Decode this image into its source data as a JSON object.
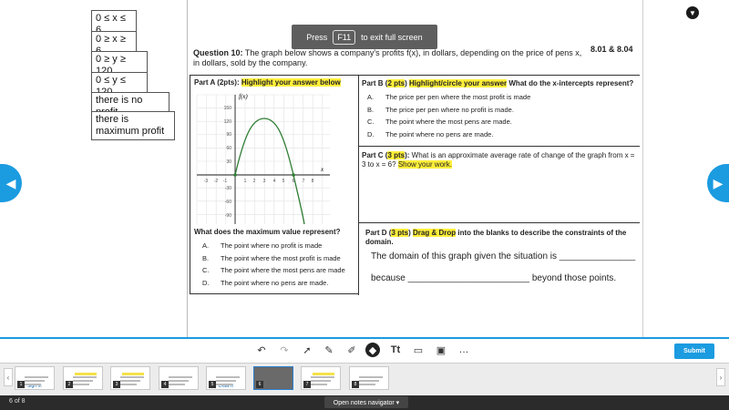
{
  "tiles": [
    {
      "text": "0 ≤ x ≤ 6"
    },
    {
      "text": "0 ≥ x ≥ 6"
    },
    {
      "text": "0 ≥ y ≥ 120"
    },
    {
      "text": "0 ≤ y ≤ 120"
    },
    {
      "text": "there is no profit"
    },
    {
      "text": "there is maximum profit"
    }
  ],
  "question": {
    "label": "Question 10:",
    "text": " The graph below shows a company's profits f(x), in dollars, depending on the price of pens x, in dollars, sold by the company.",
    "standards": "8.01 & 8.04"
  },
  "part_a": {
    "head": "Part A (2pts): ",
    "highlight": "Highlight your answer below",
    "prompt": "What does the maximum value represent?",
    "options": [
      {
        "letter": "A.",
        "text": "The point where no profit is made"
      },
      {
        "letter": "B.",
        "text": "The point where the most profit is made"
      },
      {
        "letter": "C.",
        "text": "The point where the most pens are made"
      },
      {
        "letter": "D.",
        "text": "The point where no pens are made."
      }
    ]
  },
  "part_b": {
    "head_pre": "Part B (",
    "pts": "2 pts",
    "head_mid": ") ",
    "highlight": "Highlight/circle your answer",
    "prompt": " What do the x-intercepts represent?",
    "options": [
      {
        "letter": "A.",
        "text": "The price per pen where the most profit is made"
      },
      {
        "letter": "B.",
        "text": "The price per pen where no profit is made."
      },
      {
        "letter": "C.",
        "text": "The point where the most pens are made."
      },
      {
        "letter": "D.",
        "text": "The point where no pens are made."
      }
    ]
  },
  "part_c": {
    "head_pre": "Part C (",
    "pts": "3 pts",
    "head_post": "):",
    "text": " What is an approximate average rate of change of the graph from x = 3 to x = 6? ",
    "highlight": "Show your work."
  },
  "part_d": {
    "head_pre": "Part D (",
    "pts": "3 pts",
    "head_mid": ") ",
    "highlight": "Drag & Drop",
    "head_post": " into the blanks to describe the constraints of the domain.",
    "line1": "The domain of this graph given the situation is _______________",
    "line2": "because ________________________ beyond those points."
  },
  "graph": {
    "ylabel": "f(x)",
    "xlabel": "x",
    "yticks": [
      "150",
      "120",
      "90",
      "60",
      "30",
      "-30",
      "-60",
      "-90"
    ],
    "xticks": [
      "-3",
      "-2",
      "-1",
      "1",
      "2",
      "3",
      "4",
      "5",
      "6",
      "7",
      "8"
    ]
  },
  "toast": {
    "pre": "Press",
    "key": "F11",
    "post": "to exit full screen"
  },
  "toolbar": {
    "submit": "Submit"
  },
  "thumbs": [
    {
      "num": "1",
      "label": "Sign In"
    },
    {
      "num": "2",
      "label": ""
    },
    {
      "num": "3",
      "label": ""
    },
    {
      "num": "4",
      "label": ""
    },
    {
      "num": "5",
      "label": "Draw It"
    },
    {
      "num": "6",
      "label": ""
    },
    {
      "num": "7",
      "label": ""
    },
    {
      "num": "8",
      "label": ""
    }
  ],
  "footer": {
    "page": "6 of 8",
    "notes": "Open notes navigator ▾"
  },
  "colors": {
    "accent": "#1b9be0",
    "highlight": "#ffef3a",
    "curve": "#2e7d32"
  }
}
